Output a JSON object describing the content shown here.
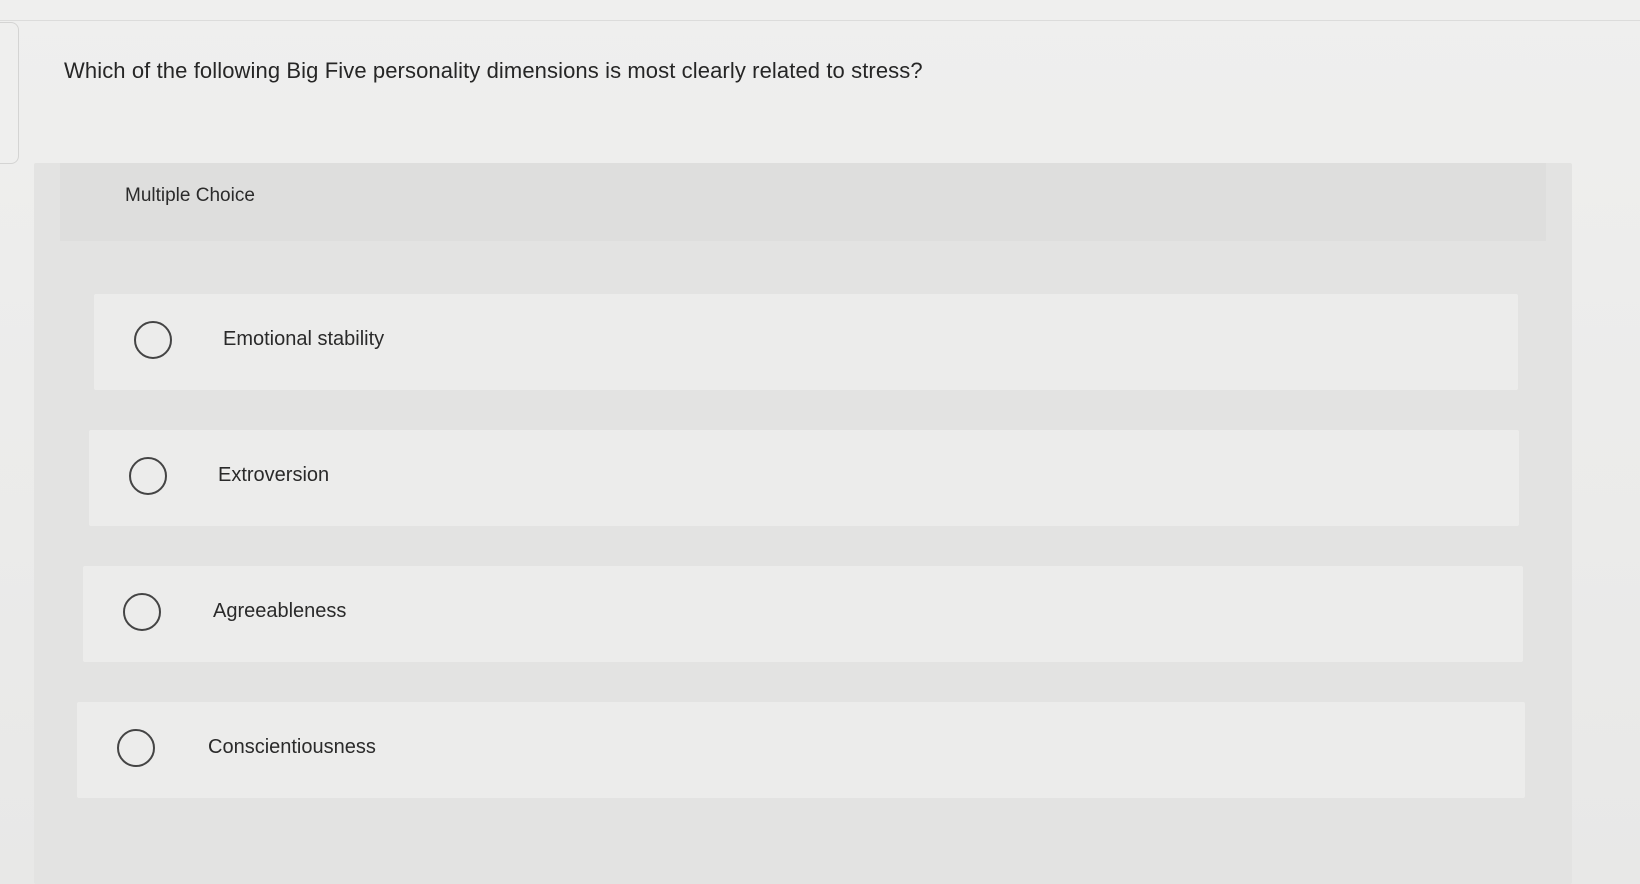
{
  "question": {
    "text": "Which of the following Big Five personality dimensions is most clearly related to stress?"
  },
  "multiple_choice": {
    "header_label": "Multiple Choice",
    "options": [
      {
        "label": "Emotional stability",
        "selected": false
      },
      {
        "label": "Extroversion",
        "selected": false
      },
      {
        "label": "Agreeableness",
        "selected": false
      },
      {
        "label": "Conscientiousness",
        "selected": false
      }
    ]
  },
  "colors": {
    "background": "#ebebea",
    "panel": "#e3e3e2",
    "option_background": "#ececeb",
    "text": "#2a2a2a",
    "radio_border": "#444444"
  },
  "icons": {
    "radio": "radio-unchecked-icon"
  }
}
